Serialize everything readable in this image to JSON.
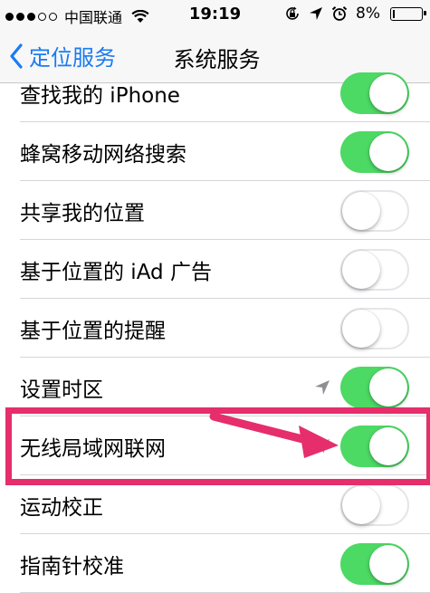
{
  "status_bar": {
    "carrier": "中国联通",
    "time": "19:19",
    "battery": "8%",
    "battery_level": 0.08,
    "signal_bars": 3,
    "signal_total": 5
  },
  "nav": {
    "back_label": "定位服务",
    "title": "系统服务"
  },
  "colors": {
    "toggle_on": "#4cd964",
    "accent": "#1a7bf0",
    "highlight": "#e52e6b"
  },
  "rows": [
    {
      "label": "查找我的 iPhone",
      "on": true,
      "location_arrow": false
    },
    {
      "label": "蜂窝移动网络搜索",
      "on": true,
      "location_arrow": false
    },
    {
      "label": "共享我的位置",
      "on": false,
      "location_arrow": false
    },
    {
      "label": "基于位置的 iAd 广告",
      "on": false,
      "location_arrow": false
    },
    {
      "label": "基于位置的提醒",
      "on": false,
      "location_arrow": false
    },
    {
      "label": "设置时区",
      "on": true,
      "location_arrow": true
    },
    {
      "label": "无线局域网联网",
      "on": true,
      "location_arrow": true
    },
    {
      "label": "运动校正",
      "on": false,
      "location_arrow": false
    },
    {
      "label": "指南针校准",
      "on": true,
      "location_arrow": false
    }
  ]
}
